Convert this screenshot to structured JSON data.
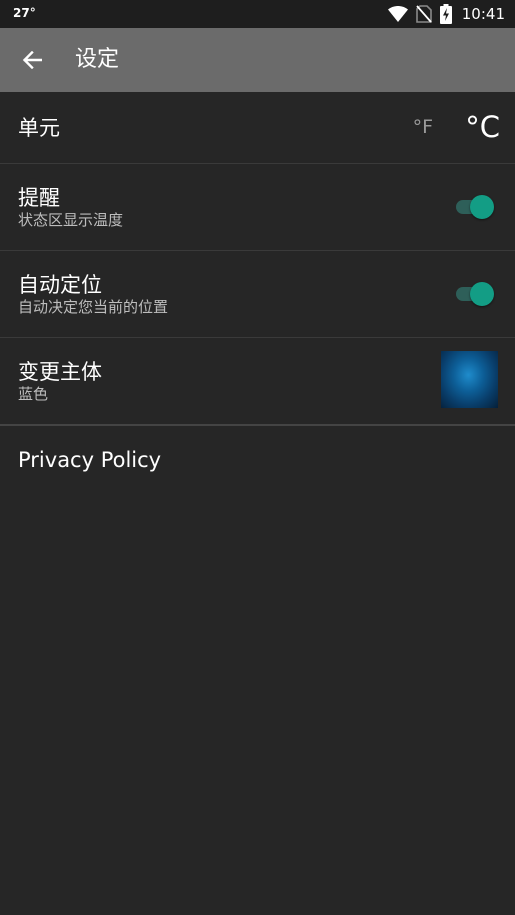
{
  "status_bar": {
    "temperature": "27°",
    "time": "10:41",
    "icons": [
      "wifi-icon",
      "no-sim-icon",
      "battery-charging-icon"
    ]
  },
  "toolbar": {
    "title": "设定",
    "back_icon": "arrow-left-icon"
  },
  "settings": {
    "unit": {
      "title": "单元",
      "option_f": "°F",
      "option_c": "°C",
      "selected": "°C"
    },
    "reminder": {
      "title": "提醒",
      "subtitle": "状态区显示温度",
      "enabled": true
    },
    "auto_location": {
      "title": "自动定位",
      "subtitle": "自动决定您当前的位置",
      "enabled": true
    },
    "theme": {
      "title": "变更主体",
      "subtitle": "蓝色"
    },
    "privacy_policy": "Privacy Policy"
  },
  "colors": {
    "background": "#262626",
    "toolbar": "#6b6b6b",
    "accent": "#139d85",
    "toggle_track": "#2e5f59"
  }
}
